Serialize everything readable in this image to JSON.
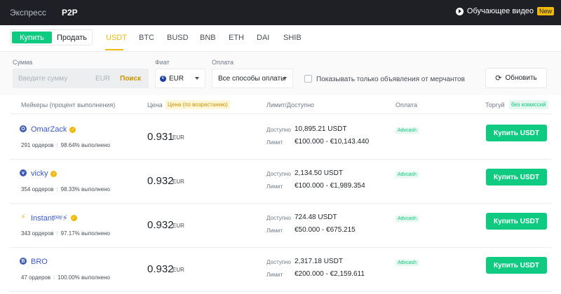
{
  "topbar": {
    "tabs": [
      {
        "label": "Экспресс"
      },
      {
        "label": "P2P"
      }
    ],
    "video_label": "Обучающее видео",
    "new_badge": "New"
  },
  "trade": {
    "buy_label": "Купить",
    "sell_label": "Продать",
    "coins": [
      "USDT",
      "BTC",
      "BUSD",
      "BNB",
      "ETH",
      "DAI",
      "SHIB"
    ],
    "active_coin": "USDT"
  },
  "filters": {
    "amount_label": "Сумма",
    "amount_placeholder": "Введите сумму",
    "amount_currency": "EUR",
    "search_label": "Поиск",
    "fiat_label": "Фиат",
    "fiat_value": "EUR",
    "payment_label": "Оплата",
    "payment_value": "Все способы оплаты",
    "merchants_only_label": "Показывать только объявления от мерчантов",
    "refresh_label": "Обновить"
  },
  "table": {
    "headers": {
      "merchant": "Мейкеры (процент выполнения)",
      "price": "Цена",
      "price_sort": "Цена (по возрастанию)",
      "limit": "Лимит/Доступно",
      "payment": "Оплата",
      "trade": "Торгуй",
      "no_fee": "без комиссий"
    },
    "available_key": "Доступно",
    "limit_key": "Лимит",
    "buy_label": "Купить USDT",
    "rows": [
      {
        "initial": "O",
        "name": "OmarZack",
        "orders": "291 ордеров",
        "completion": "98.64% выполнено",
        "price": "0.931",
        "currency": "EUR",
        "available": "10,895.21 USDT",
        "limit": "€100.000 - €10,143.440",
        "payment": "Advcash"
      },
      {
        "initial": "v",
        "name": "vicky",
        "orders": "354 ордеров",
        "completion": "98.33% выполнено",
        "price": "0.932",
        "currency": "EUR",
        "available": "2,134.50 USDT",
        "limit": "€100.000 - €1,989.354",
        "payment": "Advcash"
      },
      {
        "initial": "⚡",
        "name": "Instantᵖᵃʸ⚡",
        "orders": "343 ордеров",
        "completion": "97.17% выполнено",
        "price": "0.932",
        "currency": "EUR",
        "available": "724.48 USDT",
        "limit": "€50.000 - €675.215",
        "payment": "Advcash"
      },
      {
        "initial": "B",
        "name": "BRO",
        "orders": "47 ордеров",
        "completion": "100.00% выполнено",
        "price": "0.932",
        "currency": "EUR",
        "available": "2,317.18 USDT",
        "limit": "€200.000 - €2,159.611",
        "payment": "Advcash"
      }
    ]
  }
}
